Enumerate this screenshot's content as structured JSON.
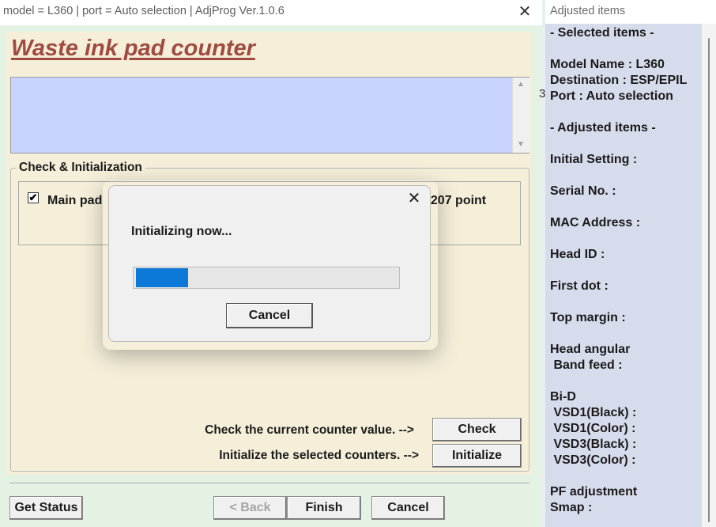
{
  "main_window": {
    "title": "model = L360 | port = Auto selection | AdjProg Ver.1.0.6",
    "close_glyph": "✕",
    "heading": "Waste ink pad counter",
    "edge_digit": "3",
    "check_group": {
      "legend": "Check & Initialization",
      "main_pad": {
        "checked": true,
        "check_glyph": "✔",
        "label": "Main pad",
        "point_text": "6207 point"
      },
      "check_prompt": "Check the current counter value. -->",
      "check_button": "Check",
      "init_prompt": "Initialize the selected counters. -->",
      "initialize_button": "Initialize"
    },
    "footer": {
      "get_status": "Get Status",
      "back": "< Back",
      "finish": "Finish",
      "cancel": "Cancel"
    }
  },
  "progress_dialog": {
    "close_glyph": "✕",
    "message": "Initializing now...",
    "progress_fraction": 0.2,
    "cancel": "Cancel",
    "accent_color": "#0c78d8"
  },
  "adjusted_panel": {
    "title": "Adjusted items",
    "lines": [
      "- Selected items -",
      "",
      "Model Name : L360",
      "Destination : ESP/EPIL",
      "Port : Auto selection",
      "",
      "- Adjusted items -",
      "",
      "Initial Setting :",
      "",
      "Serial No. :",
      "",
      "MAC Address :",
      "",
      "Head ID :",
      "",
      "First dot :",
      "",
      "Top margin :",
      "",
      "Head angular",
      " Band feed :",
      "",
      "Bi-D",
      " VSD1(Black) :",
      " VSD1(Color) :",
      " VSD3(Black) :",
      " VSD3(Color) :",
      "",
      "PF adjustment",
      "Smap :"
    ]
  }
}
